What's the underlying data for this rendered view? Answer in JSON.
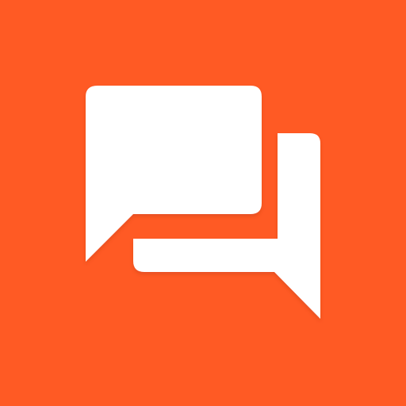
{
  "app_icon": {
    "icon_name": "chat-bubbles-icon",
    "colors": {
      "background": "#ff5a24",
      "bubble": "#ffffff",
      "shadow": "#b83a14"
    }
  }
}
